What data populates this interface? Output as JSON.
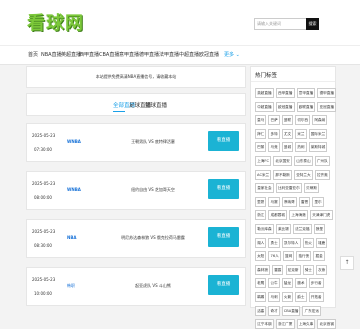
{
  "header": {
    "logo": "看球网",
    "search_placeholder": "请输入关键词",
    "search_button": "搜索"
  },
  "nav": {
    "items": [
      "首页",
      "NBA直播",
      "英超直播",
      "西甲直播",
      "CBA直播",
      "意甲直播",
      "德甲直播",
      "法甲直播",
      "中超直播",
      "欧冠直播"
    ],
    "more": "更多"
  },
  "notice": "本站提供免费高清NBA直播信号，请收藏本站",
  "tabs": [
    "全部直播",
    "足球直播",
    "篮球直播"
  ],
  "matches": [
    {
      "date": "2025-05-23",
      "time": "07:30:00",
      "league": "WNBA",
      "teams": "王朝男队 VS 底特律活塞",
      "button": "看直播"
    },
    {
      "date": "2025-05-23",
      "time": "08:00:00",
      "league": "WNBA",
      "teams": "纽约自由 VS 芝加哥天空",
      "button": "看直播"
    },
    {
      "date": "2025-05-23",
      "time": "08:30:00",
      "league": "NBA",
      "teams": "明尼苏达森林狼 VS 俄克拉荷马雷霆",
      "button": "看直播"
    },
    {
      "date": "2025-05-23",
      "time": "10:00:00",
      "league": "韩职",
      "teams": "起亚虎队 VS 斗山熊",
      "button": "看直播"
    }
  ],
  "sidebar": {
    "title": "热门标签",
    "rows": [
      [
        "英超直播",
        "西甲直播",
        "意甲直播",
        "德甲直播",
        "法甲直播"
      ],
      [
        "中超直播",
        "欧冠直播",
        "欧联直播",
        "亚冠直播"
      ],
      [
        "皇马",
        "巴萨",
        "曼联",
        "切尔西",
        "阿森纳",
        "利物浦"
      ],
      [
        "拜仁",
        "多特",
        "尤文",
        "米兰",
        "国际米兰",
        "罗马"
      ],
      [
        "巴黎",
        "马竞",
        "曼城",
        "热刺",
        "莱斯特城"
      ],
      [
        "上海FC",
        "北京国安",
        "山东泰山",
        "广州队"
      ],
      [
        "AC米兰",
        "那不勒斯",
        "亚特兰大",
        "拉齐奥",
        "塞维利亚"
      ],
      [
        "皇家社会",
        "比利亚雷亚尔",
        "贝蒂斯",
        "瓦伦西亚"
      ],
      [
        "里昂",
        "马赛",
        "摩纳哥",
        "雷恩",
        "里尔",
        "尼斯"
      ],
      [
        "浙江",
        "成都蓉城",
        "上海海港",
        "天津津门虎"
      ],
      [
        "勒沃库森",
        "莱比锡",
        "法兰克福",
        "狼堡",
        "NBA"
      ],
      [
        "湖人",
        "勇士",
        "凯尔特人",
        "热火",
        "雄鹿",
        "快船"
      ],
      [
        "太阳",
        "76人",
        "篮网",
        "独行侠",
        "掘金"
      ],
      [
        "森林狼",
        "雷霆",
        "尼克斯",
        "骑士",
        "灰熊",
        "国王"
      ],
      [
        "老鹰",
        "公牛",
        "猛龙",
        "魔术",
        "步行者"
      ],
      [
        "鹈鹕",
        "马刺",
        "火箭",
        "爵士",
        "开拓者",
        "黄蜂"
      ],
      [
        "活塞",
        "奇才",
        "CBA直播",
        "广东宏远"
      ],
      [
        "辽宁本钢",
        "浙江广厦",
        "上海久事",
        "北京首钢"
      ]
    ]
  },
  "to_top": "↑"
}
